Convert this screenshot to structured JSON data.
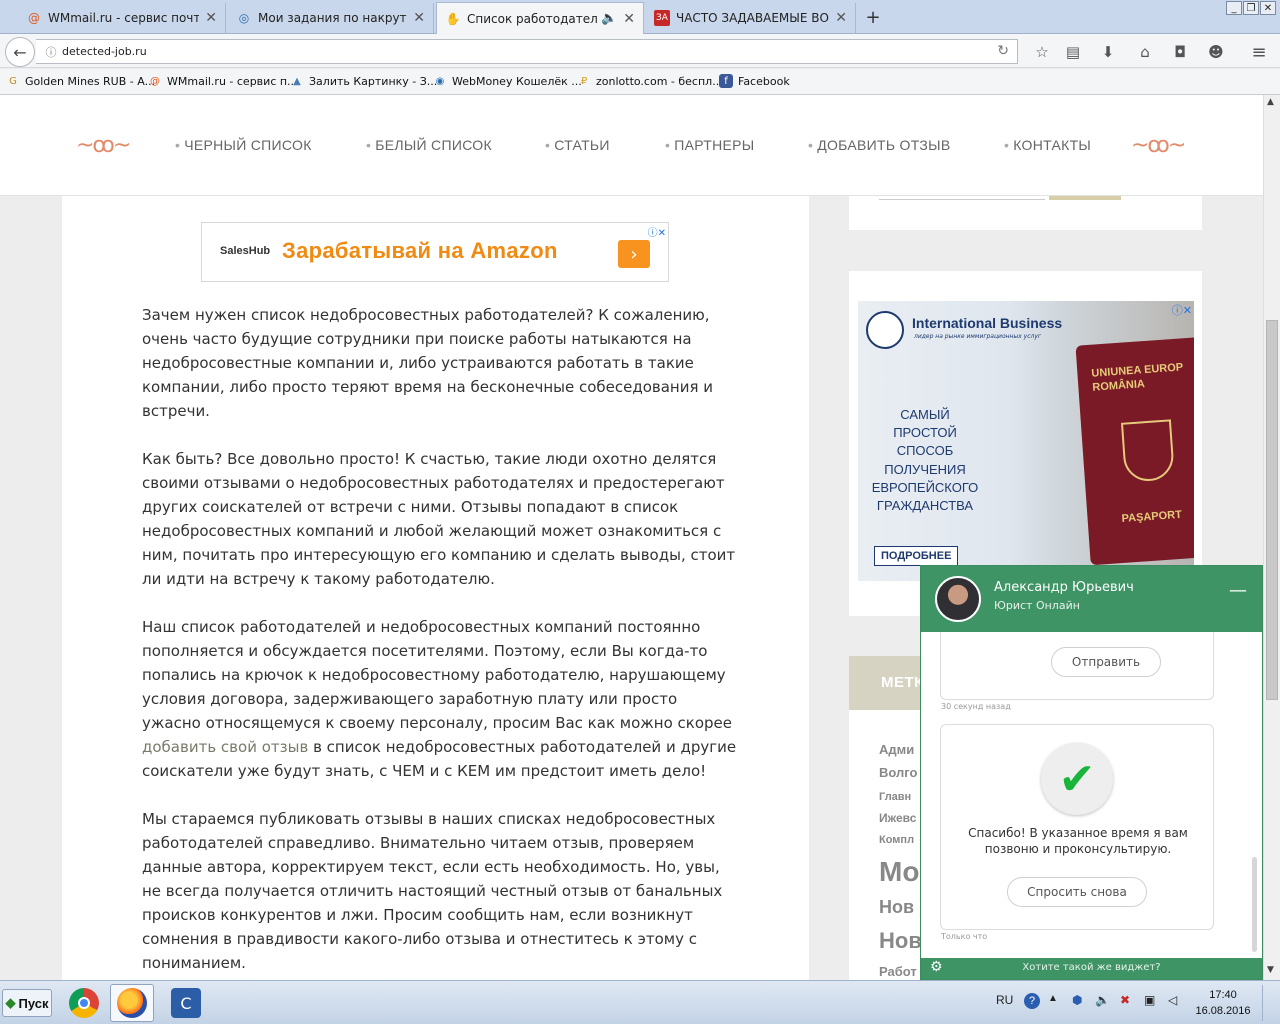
{
  "browser": {
    "tabs": [
      {
        "label": "WMmail.ru - сервис почтовы...",
        "icon": "at-icon",
        "icon_char": "@",
        "icon_color": "#e05a1b"
      },
      {
        "label": "Мои задания по накрутке",
        "icon": "target-icon",
        "icon_char": "◎",
        "icon_color": "#2a6fb0"
      },
      {
        "label": "Список работодателей",
        "icon": "hand-icon",
        "icon_char": "✋",
        "icon_color": "#333333"
      },
      {
        "label": "ЧАСТО ЗАДАВАЕМЫЕ ВОПР...",
        "icon": "za-icon",
        "icon_char": "ЗА",
        "icon_color": "#c62828"
      }
    ],
    "new_tab_label": "+",
    "url": "detected-job.ru",
    "bookmarks": [
      {
        "label": "Golden Mines RUB - A...",
        "icon_char": "G",
        "icon_color": "#c98a12"
      },
      {
        "label": "WMmail.ru - сервис п...",
        "icon_char": "@",
        "icon_color": "#e05a1b"
      },
      {
        "label": "Залить Картинку - З...",
        "icon_char": "▲",
        "icon_color": "#4a7fb5"
      },
      {
        "label": "WebMoney Кошелёк ...",
        "icon_char": "◉",
        "icon_color": "#2a6fb0"
      },
      {
        "label": "zonlotto.com - беспл...",
        "icon_char": "₽",
        "icon_color": "#d4a017"
      },
      {
        "label": "Facebook",
        "icon_char": "f",
        "icon_color": "#3b5998"
      }
    ]
  },
  "site": {
    "menu": [
      "ЧЕРНЫЙ СПИСОК",
      "БЕЛЫЙ СПИСОК",
      "СТАТЬИ",
      "ПАРТНЕРЫ",
      "ДОБАВИТЬ ОТЗЫВ",
      "КОНТАКТЫ"
    ],
    "ad_banner": {
      "logo": "SalesHub",
      "headline": "Зарабатывай на Amazon"
    },
    "paragraphs": [
      "Зачем нужен список недобросовестных работодателей? К сожалению, очень часто будущие сотрудники при поиске работы натыкаются на недобросовестные компании и, либо устраиваются работать в такие компании, либо просто теряют время на бесконечные собеседования и встречи.",
      "Как быть? Все довольно просто! К счастью, такие люди охотно делятся своими отзывами о недобросовестных работодателях и предостерегают других соискателей от встречи с ними. Отзывы попадают в список недобросовестных компаний и любой желающий может ознакомиться с ним, почитать про интересующую его компанию и сделать выводы, стоит ли идти на встречу к такому работодателю."
    ],
    "paragraph3_before_link": "Наш список работодателей и недобросовестных компаний постоянно пополняется и обсуждается посетителями. Поэтому, если Вы когда-то попались на крючок к недобросовестному работодателю, нарушающему условия договора, задерживающего заработную плату или просто ужасно относящемуся к своему персоналу, просим Вас как можно скорее ",
    "paragraph3_link": "добавить свой отзыв",
    "paragraph3_after_link": " в список недобросовестных работодателей и другие соискатели уже будут знать, с ЧЕМ и с КЕМ им предстоит иметь дело!",
    "paragraph4": "Мы стараемся публиковать отзывы в наших списках недобросовестных работодателей справедливо. Внимательно читаем отзыв, проверяем данные автора, корректируем текст, если есть необходимость. Но, увы, не всегда получается отличить настоящий честный отзыв от банальных происков конкурентов и лжи. Просим сообщить нам, если возникнут сомнения в правдивости какого-либо отзыва и отнеститесь к этому с пониманием.",
    "sidebar_ad": {
      "brand": "International Business",
      "brand_sub": "лидер на рынке иммиграционных услуг",
      "tagline1": "САМЫЙ ПРОСТОЙ СПОСОБ",
      "tagline2": "ПОЛУЧЕНИЯ ЕВРОПЕЙСКОГО ГРАЖДАНСТВА",
      "button": "ПОДРОБНЕЕ",
      "passport_top": "UNIUNEA EUROP ROMÂNIA",
      "passport_bottom": "PAŞAPORT"
    },
    "sidebar_title": "МЕТК",
    "tags": [
      "Адми",
      "Волго",
      "Главн",
      "Ижевс",
      "Компл",
      "Мо",
      "Нов",
      "Нов",
      "Работ"
    ]
  },
  "chat": {
    "name": "Александр Юрьевич",
    "role": "Юрист Онлайн",
    "minimize": "—",
    "send_button": "Отправить",
    "stamp1": "30 секунд назад",
    "thanks": "Спасибо! В указанное время я вам позвоню и проконсультирую.",
    "ask_again": "Спросить снова",
    "stamp2": "Только что",
    "footer": "Хотите такой же виджет?"
  },
  "taskbar": {
    "start": "Пуск",
    "lang": "RU",
    "time": "17:40",
    "date": "16.08.2016"
  }
}
